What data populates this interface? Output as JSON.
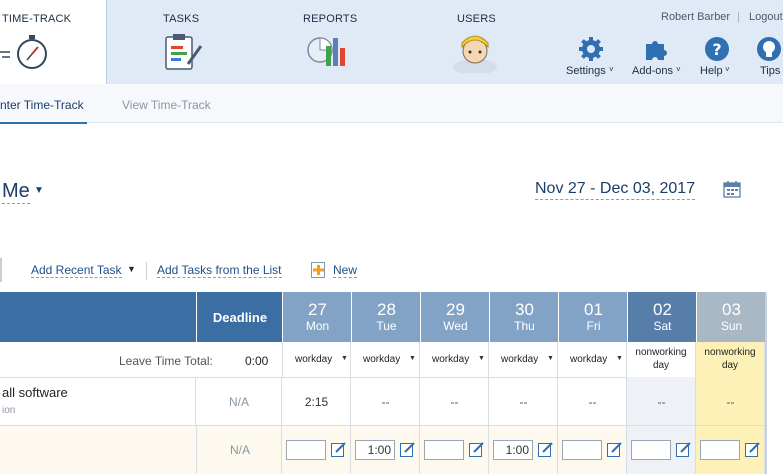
{
  "nav": {
    "time_track": "TIME-TRACK",
    "tasks": "TASKS",
    "reports": "REPORTS",
    "users": "USERS"
  },
  "user": {
    "name": "Robert Barber",
    "separator": "|",
    "logout": "Logout"
  },
  "tools": [
    {
      "label": "Settings",
      "icon": "gear-icon"
    },
    {
      "label": "Add-ons",
      "icon": "puzzle-icon"
    },
    {
      "label": "Help",
      "icon": "help-icon"
    },
    {
      "label": "Tips",
      "icon": "lightbulb-icon"
    }
  ],
  "tabs": {
    "enter": "nter Time-Track",
    "view": "View Time-Track"
  },
  "selector": {
    "user": "Me",
    "date_range": "Nov 27 - Dec 03, 2017"
  },
  "actions": {
    "add_recent": "Add Recent Task",
    "add_from_list": "Add Tasks from the List",
    "new": "New"
  },
  "grid": {
    "deadline_label": "Deadline",
    "days": [
      {
        "num": "27",
        "name": "Mon"
      },
      {
        "num": "28",
        "name": "Tue"
      },
      {
        "num": "29",
        "name": "Wed"
      },
      {
        "num": "30",
        "name": "Thu"
      },
      {
        "num": "01",
        "name": "Fri"
      },
      {
        "num": "02",
        "name": "Sat"
      },
      {
        "num": "03",
        "name": "Sun"
      }
    ],
    "leave_label": "Leave Time Total:",
    "leave_total": "0:00",
    "day_types": [
      "workday",
      "workday",
      "workday",
      "workday",
      "workday",
      "nonworking day",
      "nonworking day"
    ],
    "task_row": {
      "name": "all software",
      "sub": "ion",
      "deadline": "N/A",
      "values": [
        "2:15",
        "--",
        "--",
        "--",
        "--",
        "--",
        "--"
      ]
    },
    "input_row": {
      "deadline": "N/A",
      "values": [
        "",
        "1:00",
        "",
        "1:00",
        "",
        "",
        ""
      ]
    }
  },
  "colors": {
    "header_dark": "#3b6ea3",
    "header_mid": "#82a3c6",
    "sunday": "#fdf1b8",
    "saturday": "#eef1f5",
    "accent": "#f0a020"
  }
}
